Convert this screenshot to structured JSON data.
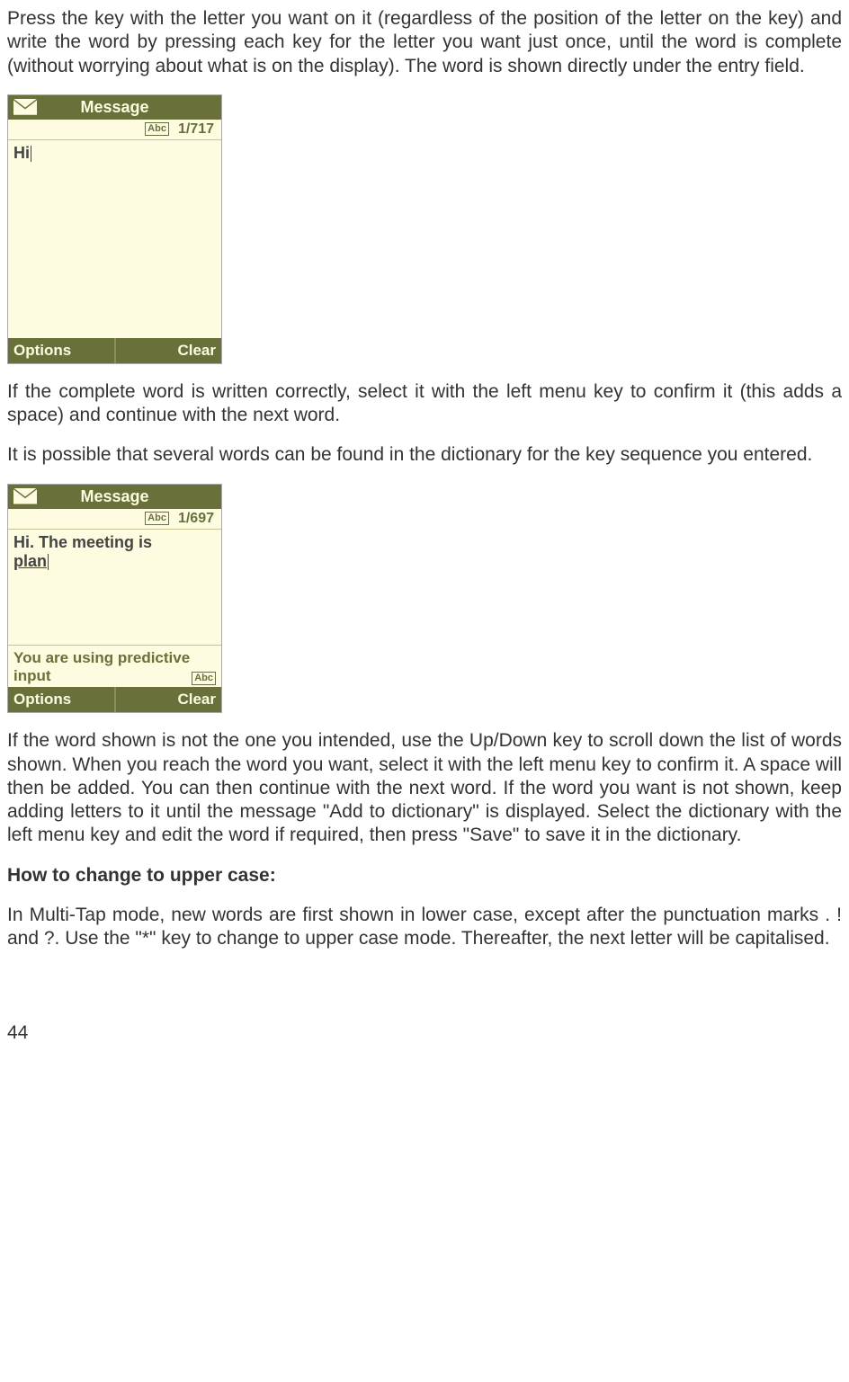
{
  "para1": "Press the key with the letter you want on it (regardless of the position of the letter on the key) and write the word by pressing each key for the letter you want just once, until the word is complete (without worrying about what is on the display). The word is shown directly under the entry field.",
  "phone1": {
    "title": "Message",
    "abc": "Abc",
    "counter": "1/717",
    "text": "Hi",
    "options": "Options",
    "clear": "Clear"
  },
  "para2": "If the complete word is written correctly, select it with the left menu key to confirm it (this adds a space) and continue with the next word.",
  "para3": "It is possible that several words can be found in the dictionary for the key sequence you entered.",
  "phone2": {
    "title": "Message",
    "abc": "Abc",
    "counter": "1/697",
    "text_prefix": "Hi. The meeting is ",
    "text_word": "plan",
    "note": "You are using predictive input",
    "options": "Options",
    "clear": "Clear"
  },
  "para4": "If the word shown is not the one you intended, use the Up/Down key to scroll down the list of words shown. When you reach the word you want, select it with the left menu key to confirm it. A space will then be added. You can then continue with the next word. If the word you want is not shown, keep adding letters to it until the message \"Add to dictionary\" is displayed. Select the dictionary with the left menu key and edit the word if required, then press \"Save\" to save it in the dictionary.",
  "heading1": "How to change to upper case:",
  "para5": "In Multi-Tap mode, new words are first shown in lower case, except after the punctuation marks . ! and ?. Use the \"*\" key to change to upper case mode. Thereafter, the next letter will be capitalised.",
  "pageNumber": "44"
}
